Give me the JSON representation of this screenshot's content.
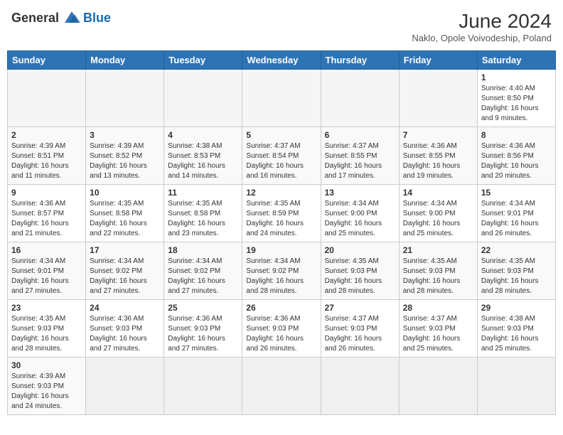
{
  "header": {
    "logo_general": "General",
    "logo_blue": "Blue",
    "month_title": "June 2024",
    "subtitle": "Naklo, Opole Voivodeship, Poland"
  },
  "weekdays": [
    "Sunday",
    "Monday",
    "Tuesday",
    "Wednesday",
    "Thursday",
    "Friday",
    "Saturday"
  ],
  "weeks": [
    [
      {
        "day": "",
        "info": ""
      },
      {
        "day": "",
        "info": ""
      },
      {
        "day": "",
        "info": ""
      },
      {
        "day": "",
        "info": ""
      },
      {
        "day": "",
        "info": ""
      },
      {
        "day": "",
        "info": ""
      },
      {
        "day": "1",
        "info": "Sunrise: 4:40 AM\nSunset: 8:50 PM\nDaylight: 16 hours\nand 9 minutes."
      }
    ],
    [
      {
        "day": "2",
        "info": "Sunrise: 4:39 AM\nSunset: 8:51 PM\nDaylight: 16 hours\nand 11 minutes."
      },
      {
        "day": "3",
        "info": "Sunrise: 4:39 AM\nSunset: 8:52 PM\nDaylight: 16 hours\nand 13 minutes."
      },
      {
        "day": "4",
        "info": "Sunrise: 4:38 AM\nSunset: 8:53 PM\nDaylight: 16 hours\nand 14 minutes."
      },
      {
        "day": "5",
        "info": "Sunrise: 4:37 AM\nSunset: 8:54 PM\nDaylight: 16 hours\nand 16 minutes."
      },
      {
        "day": "6",
        "info": "Sunrise: 4:37 AM\nSunset: 8:55 PM\nDaylight: 16 hours\nand 17 minutes."
      },
      {
        "day": "7",
        "info": "Sunrise: 4:36 AM\nSunset: 8:55 PM\nDaylight: 16 hours\nand 19 minutes."
      },
      {
        "day": "8",
        "info": "Sunrise: 4:36 AM\nSunset: 8:56 PM\nDaylight: 16 hours\nand 20 minutes."
      }
    ],
    [
      {
        "day": "9",
        "info": "Sunrise: 4:36 AM\nSunset: 8:57 PM\nDaylight: 16 hours\nand 21 minutes."
      },
      {
        "day": "10",
        "info": "Sunrise: 4:35 AM\nSunset: 8:58 PM\nDaylight: 16 hours\nand 22 minutes."
      },
      {
        "day": "11",
        "info": "Sunrise: 4:35 AM\nSunset: 8:58 PM\nDaylight: 16 hours\nand 23 minutes."
      },
      {
        "day": "12",
        "info": "Sunrise: 4:35 AM\nSunset: 8:59 PM\nDaylight: 16 hours\nand 24 minutes."
      },
      {
        "day": "13",
        "info": "Sunrise: 4:34 AM\nSunset: 9:00 PM\nDaylight: 16 hours\nand 25 minutes."
      },
      {
        "day": "14",
        "info": "Sunrise: 4:34 AM\nSunset: 9:00 PM\nDaylight: 16 hours\nand 25 minutes."
      },
      {
        "day": "15",
        "info": "Sunrise: 4:34 AM\nSunset: 9:01 PM\nDaylight: 16 hours\nand 26 minutes."
      }
    ],
    [
      {
        "day": "16",
        "info": "Sunrise: 4:34 AM\nSunset: 9:01 PM\nDaylight: 16 hours\nand 27 minutes."
      },
      {
        "day": "17",
        "info": "Sunrise: 4:34 AM\nSunset: 9:02 PM\nDaylight: 16 hours\nand 27 minutes."
      },
      {
        "day": "18",
        "info": "Sunrise: 4:34 AM\nSunset: 9:02 PM\nDaylight: 16 hours\nand 27 minutes."
      },
      {
        "day": "19",
        "info": "Sunrise: 4:34 AM\nSunset: 9:02 PM\nDaylight: 16 hours\nand 28 minutes."
      },
      {
        "day": "20",
        "info": "Sunrise: 4:35 AM\nSunset: 9:03 PM\nDaylight: 16 hours\nand 28 minutes."
      },
      {
        "day": "21",
        "info": "Sunrise: 4:35 AM\nSunset: 9:03 PM\nDaylight: 16 hours\nand 28 minutes."
      },
      {
        "day": "22",
        "info": "Sunrise: 4:35 AM\nSunset: 9:03 PM\nDaylight: 16 hours\nand 28 minutes."
      }
    ],
    [
      {
        "day": "23",
        "info": "Sunrise: 4:35 AM\nSunset: 9:03 PM\nDaylight: 16 hours\nand 28 minutes."
      },
      {
        "day": "24",
        "info": "Sunrise: 4:36 AM\nSunset: 9:03 PM\nDaylight: 16 hours\nand 27 minutes."
      },
      {
        "day": "25",
        "info": "Sunrise: 4:36 AM\nSunset: 9:03 PM\nDaylight: 16 hours\nand 27 minutes."
      },
      {
        "day": "26",
        "info": "Sunrise: 4:36 AM\nSunset: 9:03 PM\nDaylight: 16 hours\nand 26 minutes."
      },
      {
        "day": "27",
        "info": "Sunrise: 4:37 AM\nSunset: 9:03 PM\nDaylight: 16 hours\nand 26 minutes."
      },
      {
        "day": "28",
        "info": "Sunrise: 4:37 AM\nSunset: 9:03 PM\nDaylight: 16 hours\nand 25 minutes."
      },
      {
        "day": "29",
        "info": "Sunrise: 4:38 AM\nSunset: 9:03 PM\nDaylight: 16 hours\nand 25 minutes."
      }
    ],
    [
      {
        "day": "30",
        "info": "Sunrise: 4:39 AM\nSunset: 9:03 PM\nDaylight: 16 hours\nand 24 minutes."
      },
      {
        "day": "",
        "info": ""
      },
      {
        "day": "",
        "info": ""
      },
      {
        "day": "",
        "info": ""
      },
      {
        "day": "",
        "info": ""
      },
      {
        "day": "",
        "info": ""
      },
      {
        "day": "",
        "info": ""
      }
    ]
  ]
}
